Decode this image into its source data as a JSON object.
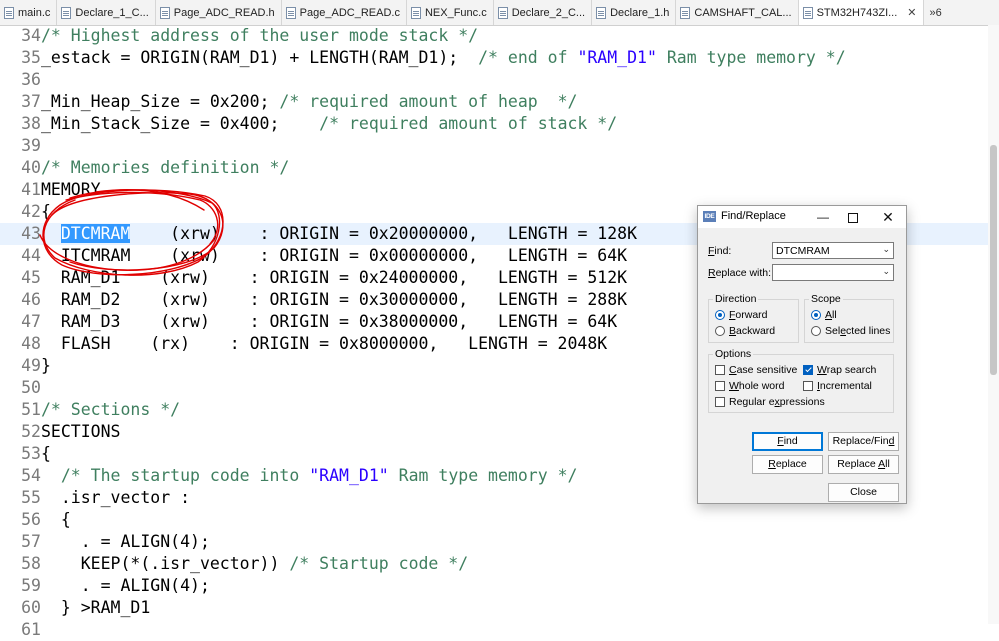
{
  "tabs": [
    {
      "label": "main.c"
    },
    {
      "label": "Declare_1_C..."
    },
    {
      "label": "Page_ADC_READ.h"
    },
    {
      "label": "Page_ADC_READ.c"
    },
    {
      "label": "NEX_Func.c"
    },
    {
      "label": "Declare_2_C..."
    },
    {
      "label": "Declare_1.h"
    },
    {
      "label": "CAMSHAFT_CAL..."
    },
    {
      "label": "STM32H743ZI...",
      "active": true,
      "close": "✕"
    }
  ],
  "tab_overflow": "»6",
  "editor": {
    "lines": [
      {
        "n": "34",
        "segs": [
          {
            "t": "/* Highest address of the user mode stack */",
            "c": "cm"
          }
        ]
      },
      {
        "n": "35",
        "segs": [
          {
            "t": "_estack = ORIGIN(RAM_D1) + LENGTH(RAM_D1);  "
          },
          {
            "t": "/* end of ",
            "c": "cm"
          },
          {
            "t": "\"RAM_D1\"",
            "c": "str"
          },
          {
            "t": " Ram type memory */",
            "c": "cm"
          }
        ]
      },
      {
        "n": "36",
        "segs": []
      },
      {
        "n": "37",
        "segs": [
          {
            "t": "_Min_Heap_Size = 0x200; "
          },
          {
            "t": "/* required amount of heap  */",
            "c": "cm"
          }
        ]
      },
      {
        "n": "38",
        "segs": [
          {
            "t": "_Min_Stack_Size = 0x400;    "
          },
          {
            "t": "/* required amount of stack */",
            "c": "cm"
          }
        ]
      },
      {
        "n": "39",
        "segs": []
      },
      {
        "n": "40",
        "segs": [
          {
            "t": "/* Memories definition */",
            "c": "cm"
          }
        ]
      },
      {
        "n": "41",
        "segs": [
          {
            "t": "MEMORY"
          }
        ]
      },
      {
        "n": "42",
        "segs": [
          {
            "t": "{"
          }
        ]
      },
      {
        "n": "43",
        "current": true,
        "segs": [
          {
            "t": "  "
          },
          {
            "t": "DTCMRAM",
            "c": "sel"
          },
          {
            "t": "    (xrw)    : ORIGIN = 0x20000000,   LENGTH = 128K"
          }
        ]
      },
      {
        "n": "44",
        "segs": [
          {
            "t": "  ITCMRAM    (xrw)    : ORIGIN = 0x00000000,   LENGTH = 64K"
          }
        ]
      },
      {
        "n": "45",
        "segs": [
          {
            "t": "  RAM_D1    (xrw)    : ORIGIN = 0x24000000,   LENGTH = 512K"
          }
        ]
      },
      {
        "n": "46",
        "segs": [
          {
            "t": "  RAM_D2    (xrw)    : ORIGIN = 0x30000000,   LENGTH = 288K"
          }
        ]
      },
      {
        "n": "47",
        "segs": [
          {
            "t": "  RAM_D3    (xrw)    : ORIGIN = 0x38000000,   LENGTH = 64K"
          }
        ]
      },
      {
        "n": "48",
        "segs": [
          {
            "t": "  FLASH    (rx)    : ORIGIN = 0x8000000,   LENGTH = 2048K"
          }
        ]
      },
      {
        "n": "49",
        "segs": [
          {
            "t": "}"
          }
        ]
      },
      {
        "n": "50",
        "segs": []
      },
      {
        "n": "51",
        "segs": [
          {
            "t": "/* Sections */",
            "c": "cm"
          }
        ]
      },
      {
        "n": "52",
        "segs": [
          {
            "t": "SECTIONS"
          }
        ]
      },
      {
        "n": "53",
        "segs": [
          {
            "t": "{"
          }
        ]
      },
      {
        "n": "54",
        "segs": [
          {
            "t": "  "
          },
          {
            "t": "/* The startup code into ",
            "c": "cm"
          },
          {
            "t": "\"RAM_D1\"",
            "c": "str"
          },
          {
            "t": " Ram type memory */",
            "c": "cm"
          }
        ]
      },
      {
        "n": "55",
        "segs": [
          {
            "t": "  .isr_vector :"
          }
        ]
      },
      {
        "n": "56",
        "segs": [
          {
            "t": "  {"
          }
        ]
      },
      {
        "n": "57",
        "segs": [
          {
            "t": "    . = ALIGN(4);"
          }
        ]
      },
      {
        "n": "58",
        "segs": [
          {
            "t": "    KEEP(*(.isr_vector)) "
          },
          {
            "t": "/* Startup code */",
            "c": "cm"
          }
        ]
      },
      {
        "n": "59",
        "segs": [
          {
            "t": "    . = ALIGN(4);"
          }
        ]
      },
      {
        "n": "60",
        "segs": [
          {
            "t": "  } >RAM_D1"
          }
        ]
      },
      {
        "n": "61",
        "segs": []
      }
    ]
  },
  "dialog": {
    "title": "Find/Replace",
    "app_icon": "IDE",
    "minimize": "—",
    "close": "✕",
    "find_label_first": "F",
    "find_label_rest": "ind:",
    "find_value": "DTCMRAM",
    "replace_label_first": "R",
    "replace_label_rest": "eplace with:",
    "replace_value": "",
    "combo_arrow": "⌄",
    "direction": {
      "title": "Direction",
      "forward_first": "F",
      "forward_rest": "orward",
      "backward_first": "B",
      "backward_rest": "ackward",
      "selected": "forward"
    },
    "scope": {
      "title": "Scope",
      "all_first": "A",
      "all_rest": "ll",
      "selected_pre": "Sel",
      "selected_u": "e",
      "selected_post": "cted lines",
      "selected": "all"
    },
    "options": {
      "title": "Options",
      "case_first": "C",
      "case_rest": "ase sensitive",
      "wrap_first": "W",
      "wrap_rest": "rap search",
      "whole_first": "W",
      "whole_rest": "hole word",
      "incr_first": "I",
      "incr_rest": "ncremental",
      "regex_pre": "Regular e",
      "regex_u": "x",
      "regex_post": "pressions",
      "case_checked": false,
      "wrap_checked": true,
      "whole_checked": false,
      "incr_checked": false,
      "regex_checked": false
    },
    "buttons": {
      "find_first": "F",
      "find_rest": "ind",
      "replace_find_pre": "Replace/Fin",
      "replace_find_u": "d",
      "replace_first": "R",
      "replace_rest": "eplace",
      "replace_all_pre": "Replace ",
      "replace_all_u": "A",
      "replace_all_post": "ll",
      "close": "Close"
    }
  },
  "colors": {
    "comment": "#3f7f5f",
    "string": "#2a00ff",
    "selection": "#3399ff",
    "current_line": "#e8f2fe",
    "annotation": "#e00000"
  }
}
